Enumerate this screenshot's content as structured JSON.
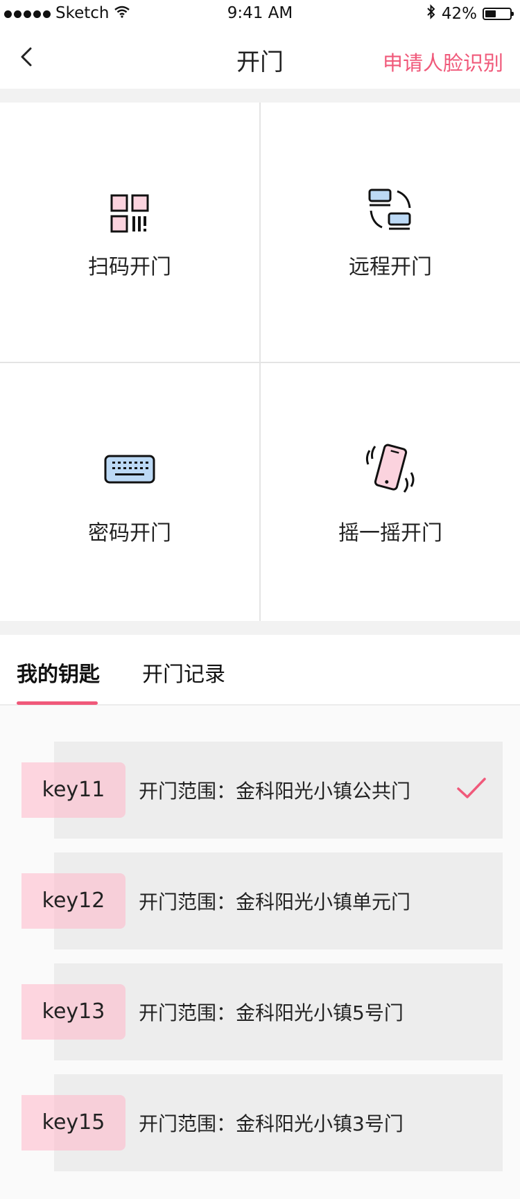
{
  "status_bar": {
    "carrier": "Sketch",
    "time": "9:41 AM",
    "battery_text": "42%",
    "battery_level": 0.42
  },
  "nav": {
    "title": "开门",
    "action": "申请人脸识别"
  },
  "methods": [
    {
      "label": "扫码开门",
      "icon": "qr-code-icon"
    },
    {
      "label": "远程开门",
      "icon": "remote-devices-icon"
    },
    {
      "label": "密码开门",
      "icon": "keyboard-icon"
    },
    {
      "label": "摇一摇开门",
      "icon": "shake-phone-icon"
    }
  ],
  "tabs": [
    {
      "label": "我的钥匙",
      "active": true
    },
    {
      "label": "开门记录",
      "active": false
    }
  ],
  "keys": [
    {
      "name": "key11",
      "range": "开门范围：金科阳光小镇公共门",
      "selected": true
    },
    {
      "name": "key12",
      "range": "开门范围：金科阳光小镇单元门",
      "selected": false
    },
    {
      "name": "key13",
      "range": "开门范围：金科阳光小镇5号门",
      "selected": false
    },
    {
      "name": "key15",
      "range": "开门范围：金科阳光小镇3号门",
      "selected": false
    }
  ],
  "colors": {
    "accent": "#f0597a",
    "icon_pink": "#fbd3de",
    "icon_blue": "#bcd9f5",
    "tag_pink": "#ffb6c8",
    "card_gray": "#ededed"
  }
}
